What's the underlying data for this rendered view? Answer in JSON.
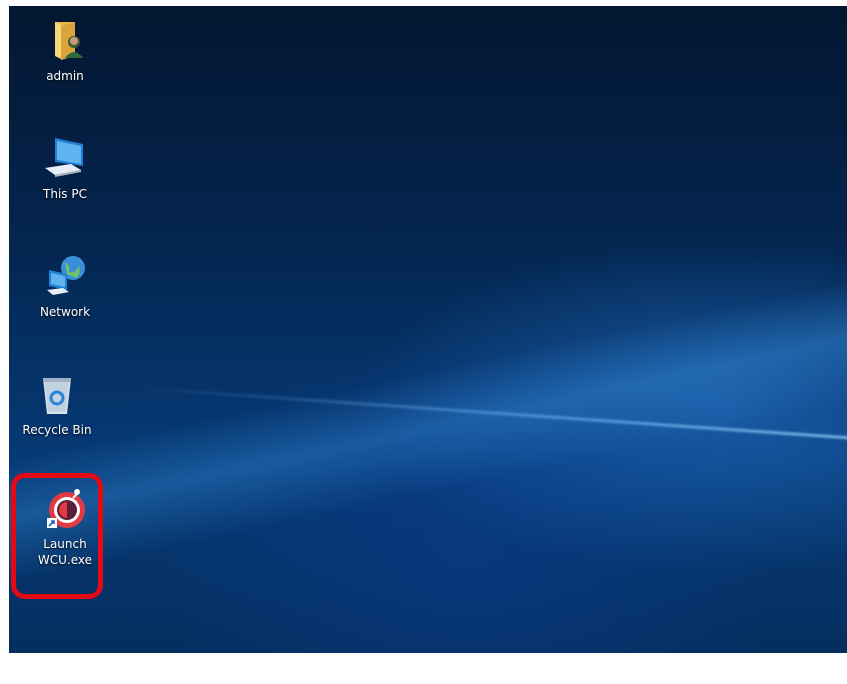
{
  "desktop": {
    "icons": [
      {
        "label": "admin",
        "icon": "user-folder-icon"
      },
      {
        "label": "This PC",
        "icon": "computer-icon"
      },
      {
        "label": "Network",
        "icon": "network-icon"
      },
      {
        "label": "Recycle Bin",
        "icon": "recycle-bin-icon"
      },
      {
        "label": "Launch WCU.exe",
        "icon": "wcu-app-icon",
        "shortcut": true,
        "highlighted": true
      }
    ]
  },
  "colors": {
    "highlight": "#e50914",
    "wallpaper_dark": "#031631",
    "wallpaper_light": "#063a76"
  }
}
